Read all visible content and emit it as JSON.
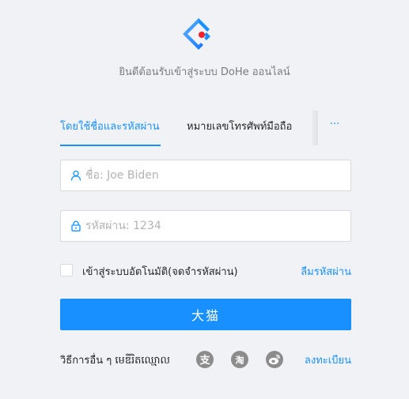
{
  "header": {
    "subtitle": "ยินดีต้อนรับเข้าสู่ระบบ DoHe ออนไลน์"
  },
  "tabs": [
    {
      "label": "โดยใช้ชื่อและรหัสผ่าน",
      "active": true
    },
    {
      "label": "หมายเลขโทรศัพท์มือถือ",
      "active": false
    }
  ],
  "tabs_more_label": "···",
  "username": {
    "value": "",
    "placeholder": "ชื่อ: Joe Biden",
    "icon": "user-icon"
  },
  "password": {
    "value": "",
    "placeholder": "รหัสผ่าน: 1234",
    "icon": "lock-icon"
  },
  "remember": {
    "label": "เข้าสู่ระบบอัตโนมัติ(จดจำรหัสผ่าน)",
    "checked": false
  },
  "forgot_label": "ลืมรหัสผ่าน",
  "submit_label": "大猫",
  "other": {
    "label": "วิธีการอื่น ๆ មេឌីរិតឈ្មោល",
    "icons": [
      "alipay-icon",
      "taobao-icon",
      "weibo-icon"
    ]
  },
  "register_label": "ลงทะเบียน",
  "colors": {
    "primary": "#1890ff",
    "background": "#f0f2f5",
    "icon_gray": "#8c8c8c",
    "logo_red": "#f5222d"
  }
}
